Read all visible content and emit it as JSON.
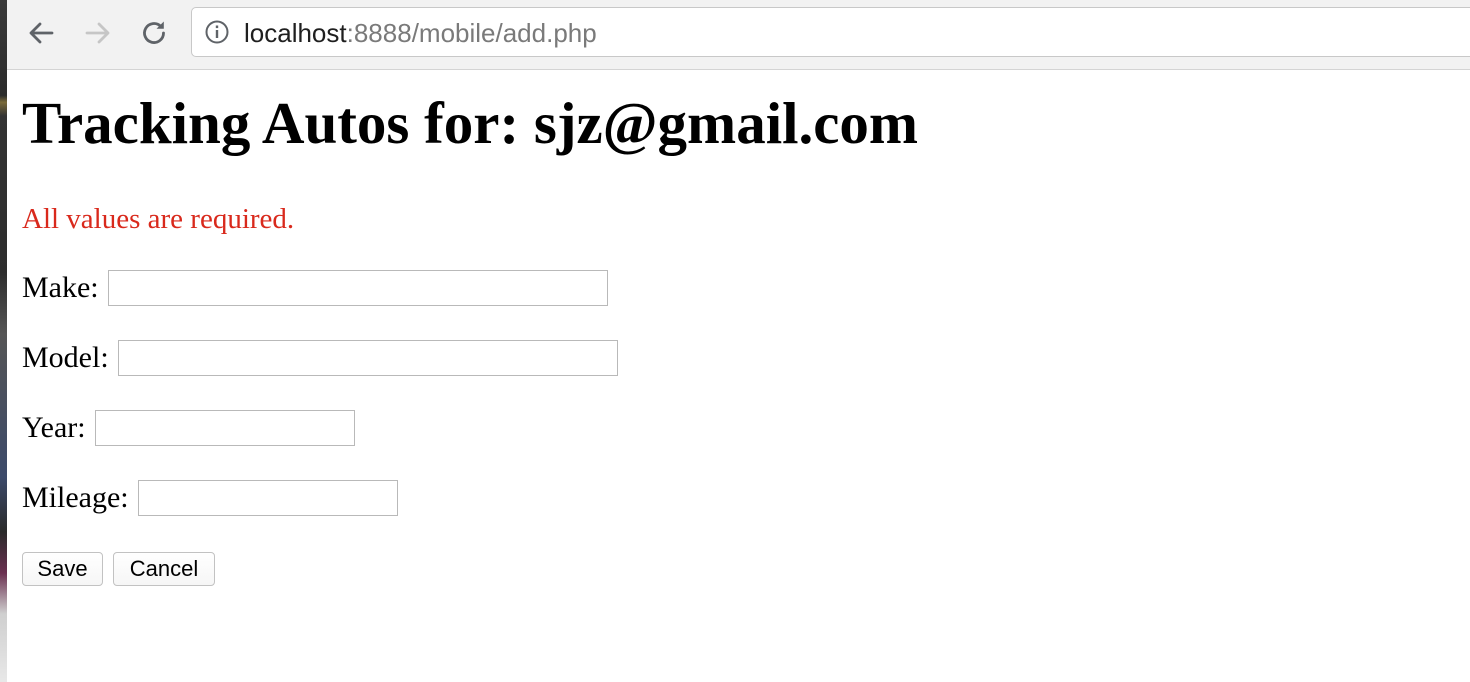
{
  "browser": {
    "url_host": "localhost",
    "url_rest": ":8888/mobile/add.php",
    "icons": {
      "back": "arrow-left-icon",
      "forward": "arrow-right-icon",
      "reload": "reload-icon",
      "info": "info-circle-icon"
    }
  },
  "page": {
    "title": "Tracking Autos for: sjz@gmail.com",
    "error_message": "All values are required.",
    "error_color": "#d9291c",
    "form": {
      "make_label": "Make:",
      "make_value": "",
      "model_label": "Model:",
      "model_value": "",
      "year_label": "Year:",
      "year_value": "",
      "mileage_label": "Mileage:",
      "mileage_value": "",
      "save_label": "Save",
      "cancel_label": "Cancel"
    }
  }
}
